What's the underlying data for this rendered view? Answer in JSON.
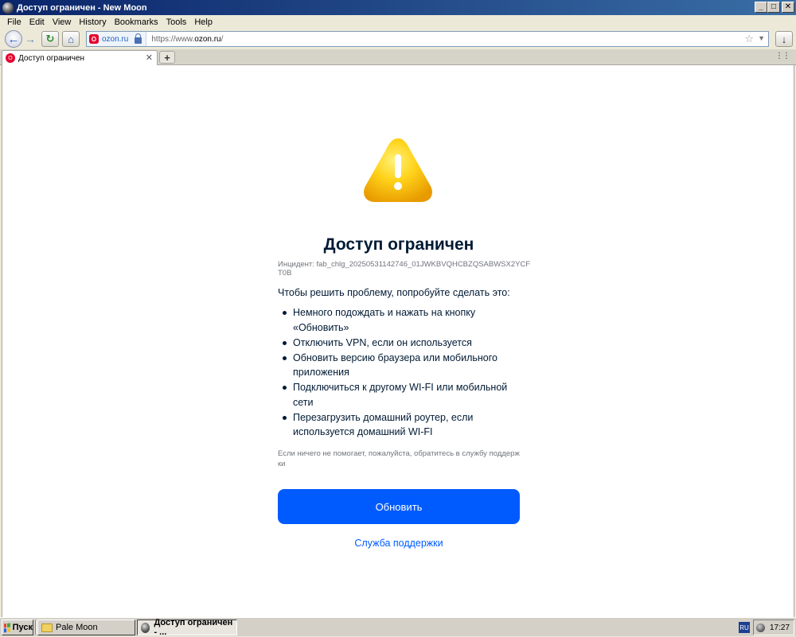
{
  "window": {
    "title": "Доступ ограничен - New Moon",
    "minimize": "_",
    "maximize": "□",
    "close": "✕"
  },
  "menu": [
    "File",
    "Edit",
    "View",
    "History",
    "Bookmarks",
    "Tools",
    "Help"
  ],
  "navbar": {
    "site_label": "ozon.ru",
    "url_prefix": "https://www.",
    "url_host": "ozon.ru",
    "url_suffix": "/"
  },
  "tab": {
    "title": "Доступ ограничен",
    "close": "✕",
    "new_tab": "+",
    "list": "⋮⋮"
  },
  "page": {
    "title": "Доступ ограничен",
    "incident": "Инцидент: fab_chlg_20250531142746_01JWKBVQHCBZQSABWSX2YCFT0B",
    "intro": "Чтобы решить проблему, попробуйте сделать это:",
    "tips": [
      "Немного подождать и нажать на кнопку «Обновить»",
      "Отключить VPN, если он используется",
      "Обновить версию браузера или мобильного приложения",
      "Подключиться к другому WI-FI или мобильной сети",
      "Перезагрузить домашний роутер, если используется домашний WI-FI"
    ],
    "note": "Если ничего не помогает, пожалуйста, обратитесь в службу поддержки",
    "refresh_button": "Обновить",
    "support_link": "Служба поддержки"
  },
  "taskbar": {
    "start": "Пуск",
    "tasks": [
      "Pale Moon",
      "Доступ ограничен - ..."
    ],
    "lang": "RU",
    "clock": "17:27"
  },
  "colors": {
    "accent": "#005bff",
    "text": "#001a34",
    "muted": "#70747b",
    "warning": "#ffc400"
  }
}
